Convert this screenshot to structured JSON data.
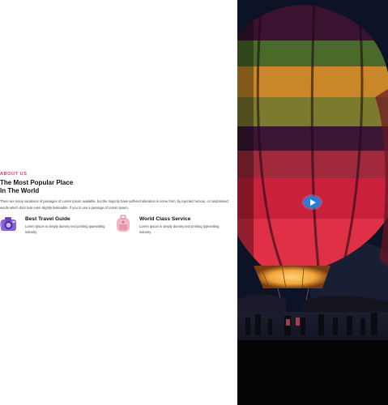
{
  "about": {
    "eyebrow": "ABOUT US",
    "title_line1": "The Most Popular Place",
    "title_line2": "In The World",
    "description": "There are many variations of passages of Lorem Ipsum available, but the majority have suffered alteration in some form, by injected humour, or randomised words which dont look even slightly believable. If you to use a passage of Lorem Ipsum."
  },
  "features": [
    {
      "icon": "camera-icon",
      "title": "Best Travel Guide",
      "text": "Lorem Ipsum is simply dummy text printing typesetting industry."
    },
    {
      "icon": "backpack-icon",
      "title": "World Class Service",
      "text": "Lorem Ipsum is simply dummy text printing typesetting industry."
    }
  ],
  "video": {
    "image": "hot-air-balloon-at-night",
    "play_icon": "play-icon"
  },
  "colors": {
    "accent": "#e8384f",
    "play_button": "#2b7bd6"
  }
}
